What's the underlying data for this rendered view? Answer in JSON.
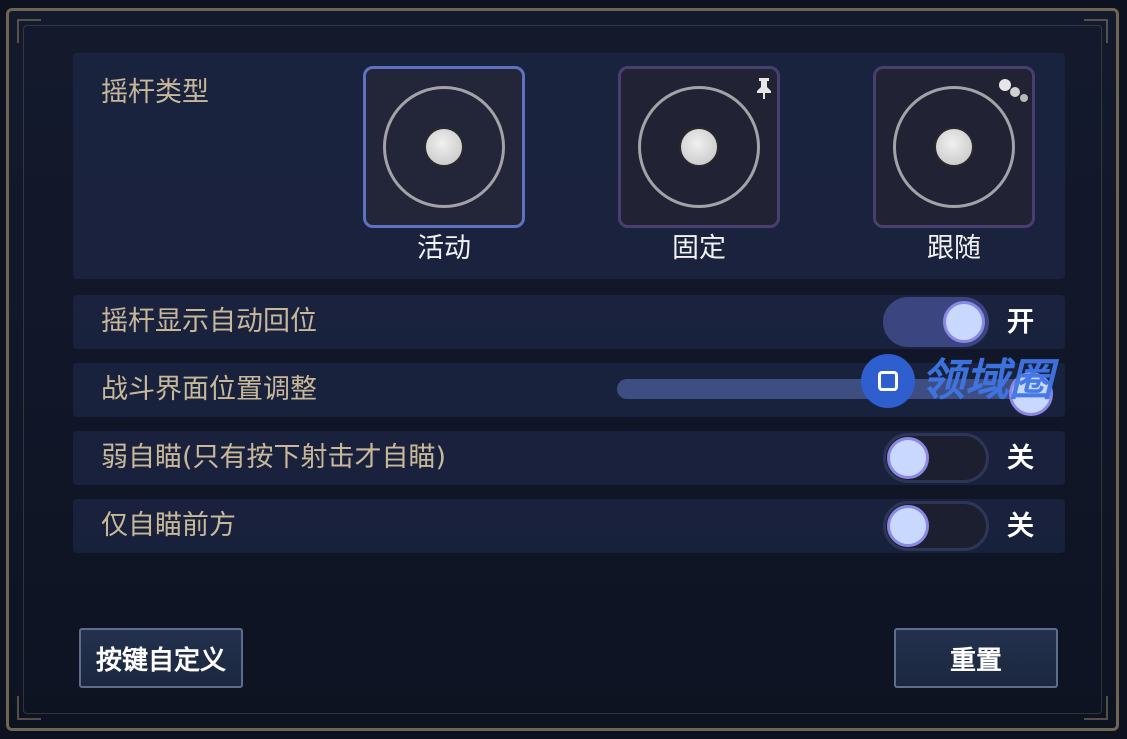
{
  "joystick_type": {
    "label": "摇杆类型",
    "options": [
      {
        "label": "活动",
        "selected": true
      },
      {
        "label": "固定",
        "selected": false,
        "icon": "pin-icon"
      },
      {
        "label": "跟随",
        "selected": false,
        "icon": "dots-icon"
      }
    ]
  },
  "settings": {
    "auto_return": {
      "label": "摇杆显示自动回位",
      "state": "开",
      "on": true
    },
    "hud_position": {
      "label": "战斗界面位置调整",
      "value_fraction": 0.96
    },
    "weak_aim": {
      "label": "弱自瞄(只有按下射击才自瞄)",
      "state": "关",
      "on": false
    },
    "front_aim": {
      "label": "仅自瞄前方",
      "state": "关",
      "on": false
    }
  },
  "watermark": {
    "text": "领域圈"
  },
  "buttons": {
    "customize": "按键自定义",
    "reset": "重置"
  },
  "colors": {
    "label_gold": "#c8b89a",
    "toggle_on": "#3b4580",
    "knob": "#c9d8ff",
    "selected_border": "#5d72c0"
  }
}
